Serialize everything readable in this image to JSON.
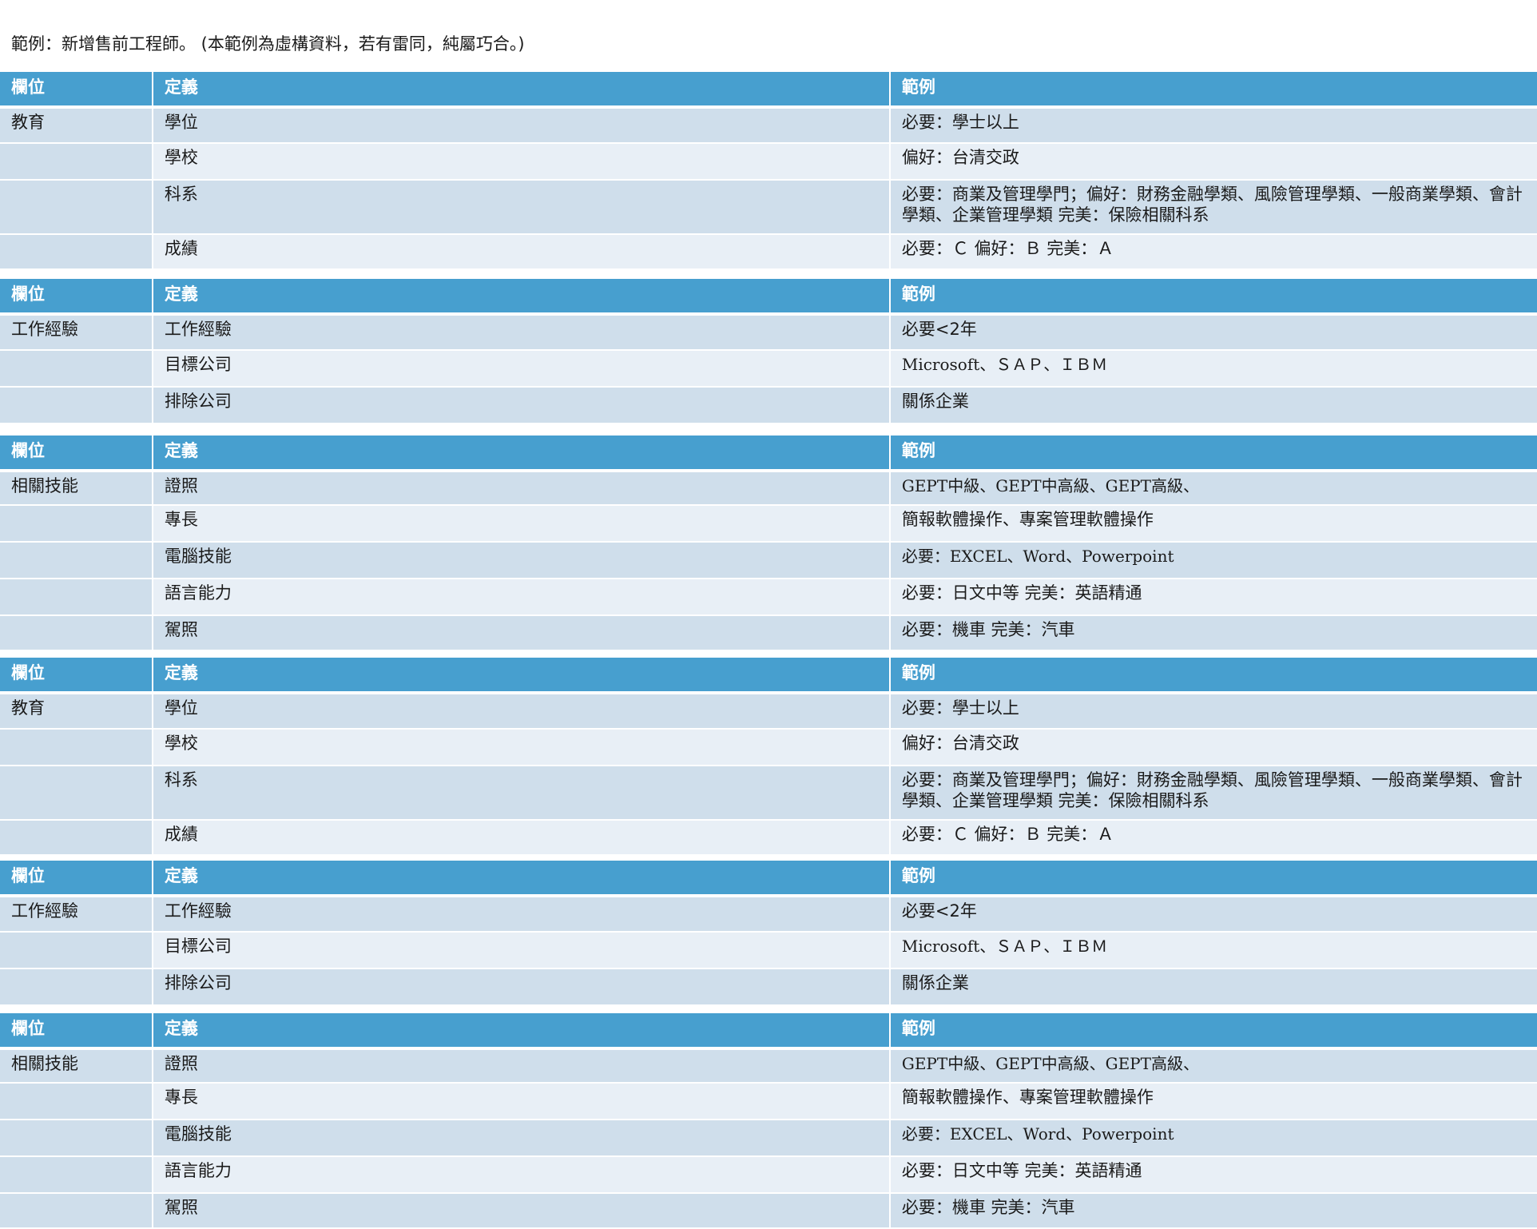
{
  "caption": "範例：新增售前工程師。 (本範例為虛構資料，若有雷同，純屬巧合。)",
  "columns": [
    "欄位",
    "定義",
    "範例"
  ],
  "tables": [
    {
      "category": "教育",
      "rows": [
        {
          "definition": "學位",
          "example": "必要：學士以上"
        },
        {
          "definition": "學校",
          "example": "偏好：台清交政"
        },
        {
          "definition": "科系",
          "example": "必要：商業及管理學門；偏好：財務金融學類、風險管理學類、一般商業學類、會計學類、企業管理學類 完美：保險相關科系"
        },
        {
          "definition": "成績",
          "example": "必要：Ｃ 偏好：Ｂ 完美：Ａ"
        }
      ]
    },
    {
      "category": "工作經驗",
      "rows": [
        {
          "definition": "工作經驗",
          "example": "必要<2年"
        },
        {
          "definition": "目標公司",
          "example": "Microsoft、ＳＡＰ、ＩＢＭ"
        },
        {
          "definition": "排除公司",
          "example": "關係企業"
        }
      ]
    },
    {
      "category": "相關技能",
      "rows": [
        {
          "definition": "證照",
          "example": "GEPT中級、GEPT中高級、GEPT高級、"
        },
        {
          "definition": "專長",
          "example": "簡報軟體操作、專案管理軟體操作"
        },
        {
          "definition": "電腦技能",
          "example": "必要：EXCEL、Word、Powerpoint"
        },
        {
          "definition": "語言能力",
          "example": "必要：日文中等 完美：英語精通"
        },
        {
          "definition": "駕照",
          "example": "必要：機車 完美：汽車"
        }
      ]
    },
    {
      "category": "教育",
      "rows": [
        {
          "definition": "學位",
          "example": "必要：學士以上"
        },
        {
          "definition": "學校",
          "example": "偏好：台清交政"
        },
        {
          "definition": "科系",
          "example": "必要：商業及管理學門；偏好：財務金融學類、風險管理學類、一般商業學類、會計學類、企業管理學類 完美：保險相關科系"
        },
        {
          "definition": "成績",
          "example": "必要：Ｃ 偏好：Ｂ 完美：Ａ"
        }
      ]
    },
    {
      "category": "工作經驗",
      "rows": [
        {
          "definition": "工作經驗",
          "example": "必要<2年"
        },
        {
          "definition": "目標公司",
          "example": "Microsoft、ＳＡＰ、ＩＢＭ"
        },
        {
          "definition": "排除公司",
          "example": "關係企業"
        }
      ]
    },
    {
      "category": "相關技能",
      "rows": [
        {
          "definition": "證照",
          "example": "GEPT中級、GEPT中高級、GEPT高級、"
        },
        {
          "definition": "專長",
          "example": "簡報軟體操作、專案管理軟體操作"
        },
        {
          "definition": "電腦技能",
          "example": "必要：EXCEL、Word、Powerpoint"
        },
        {
          "definition": "語言能力",
          "example": "必要：日文中等 完美：英語精通"
        },
        {
          "definition": "駕照",
          "example": "必要：機車 完美：汽車"
        }
      ]
    }
  ],
  "colors": {
    "header_bg": "#479fcf",
    "header_text": "#ffffff",
    "row_dark": "#cfdeeb",
    "row_light": "#e8eff6"
  }
}
